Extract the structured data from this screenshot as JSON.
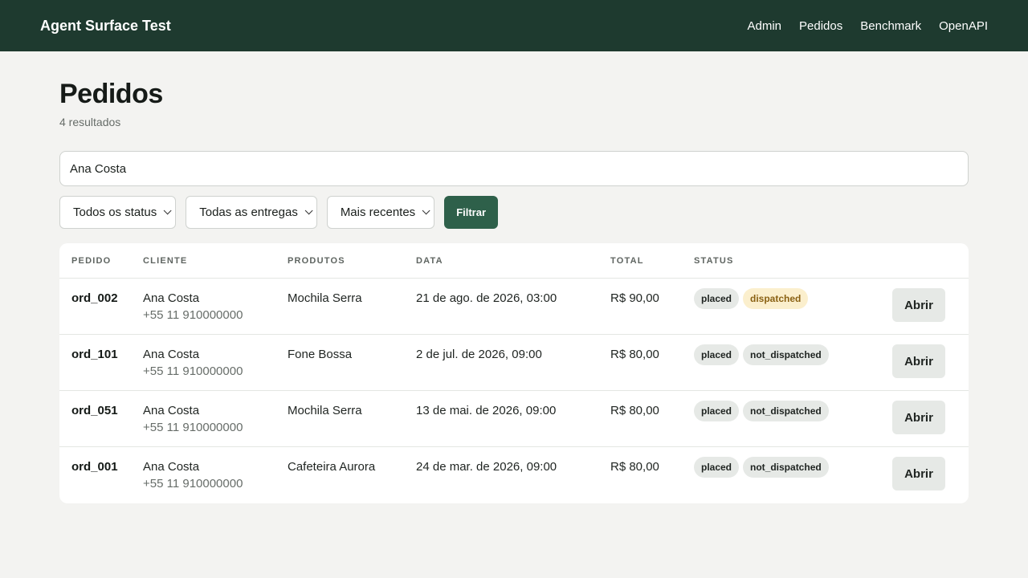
{
  "header": {
    "brand": "Agent Surface Test",
    "nav": [
      "Admin",
      "Pedidos",
      "Benchmark",
      "OpenAPI"
    ]
  },
  "page": {
    "title": "Pedidos",
    "result_count": "4 resultados"
  },
  "search": {
    "value": "Ana Costa"
  },
  "filters": {
    "status": "Todos os status",
    "delivery": "Todas as entregas",
    "sort": "Mais recentes",
    "submit_label": "Filtrar"
  },
  "table": {
    "columns": [
      "PEDIDO",
      "CLIENTE",
      "PRODUTOS",
      "DATA",
      "TOTAL",
      "STATUS"
    ],
    "action_label": "Abrir",
    "rows": [
      {
        "id": "ord_002",
        "customer": "Ana Costa",
        "phone": "+55 11 910000000",
        "products": "Mochila Serra",
        "date": "21 de ago. de 2026, 03:00",
        "total": "R$ 90,00",
        "status": "placed",
        "delivery": "dispatched"
      },
      {
        "id": "ord_101",
        "customer": "Ana Costa",
        "phone": "+55 11 910000000",
        "products": "Fone Bossa",
        "date": "2 de jul. de 2026, 09:00",
        "total": "R$ 80,00",
        "status": "placed",
        "delivery": "not_dispatched"
      },
      {
        "id": "ord_051",
        "customer": "Ana Costa",
        "phone": "+55 11 910000000",
        "products": "Mochila Serra",
        "date": "13 de mai. de 2026, 09:00",
        "total": "R$ 80,00",
        "status": "placed",
        "delivery": "not_dispatched"
      },
      {
        "id": "ord_001",
        "customer": "Ana Costa",
        "phone": "+55 11 910000000",
        "products": "Cafeteira Aurora",
        "date": "24 de mar. de 2026, 09:00",
        "total": "R$ 80,00",
        "status": "placed",
        "delivery": "not_dispatched"
      }
    ]
  },
  "colors": {
    "header_bg": "#1e3a2f",
    "primary_button": "#2e604a",
    "badge_neutral": "#e6e9e6",
    "badge_dispatched_bg": "#fbefcd",
    "badge_dispatched_text": "#8a6113"
  }
}
